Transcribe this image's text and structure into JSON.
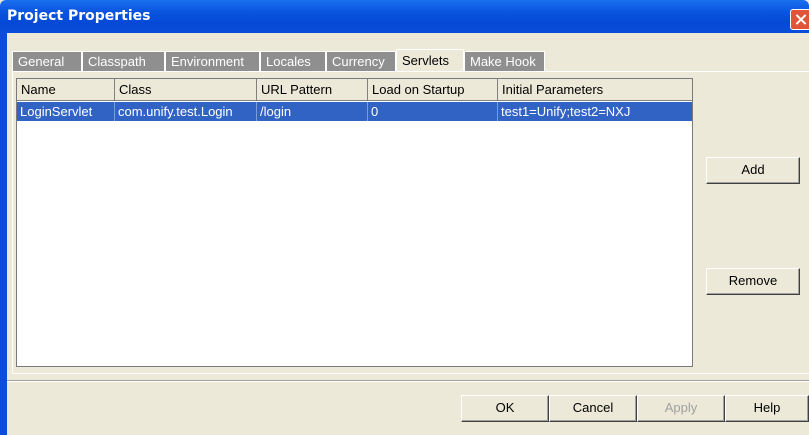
{
  "window": {
    "title": "Project Properties"
  },
  "tabs": [
    {
      "label": "General"
    },
    {
      "label": "Classpath"
    },
    {
      "label": "Environment"
    },
    {
      "label": "Locales"
    },
    {
      "label": "Currency"
    },
    {
      "label": "Servlets",
      "active": true
    },
    {
      "label": "Make Hook"
    }
  ],
  "table": {
    "columns": [
      "Name",
      "Class",
      "URL Pattern",
      "Load on Startup",
      "Initial Parameters"
    ],
    "rows": [
      {
        "name": "LoginServlet",
        "class": "com.unify.test.Login",
        "url_pattern": "/login",
        "load_on_startup": "0",
        "initial_parameters": "test1=Unify;test2=NXJ",
        "selected": true
      }
    ]
  },
  "side_buttons": {
    "add": "Add",
    "remove": "Remove"
  },
  "footer_buttons": {
    "ok": "OK",
    "cancel": "Cancel",
    "apply": "Apply",
    "help": "Help"
  },
  "colors": {
    "titlebar": "#0a4ed8",
    "selection": "#3163c4",
    "dialog_bg": "#ece9d8",
    "close_button": "#e0553a"
  }
}
